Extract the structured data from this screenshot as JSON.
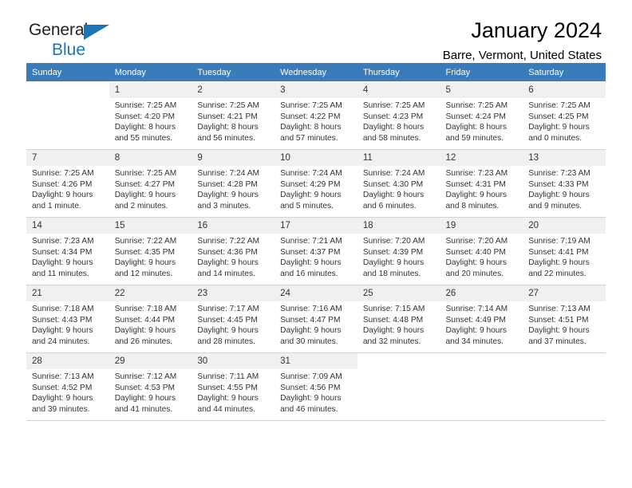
{
  "brand": {
    "name_part1": "General",
    "name_part2": "Blue",
    "accent_color": "#1b75bb"
  },
  "header": {
    "title": "January 2024",
    "subtitle": "Barre, Vermont, United States"
  },
  "calendar": {
    "header_bg": "#3a7cb9",
    "daynum_bg": "#f0f0f0",
    "weekday_headers": [
      "Sunday",
      "Monday",
      "Tuesday",
      "Wednesday",
      "Thursday",
      "Friday",
      "Saturday"
    ],
    "weeks": [
      [
        {
          "day": "",
          "sunrise": "",
          "sunset": "",
          "daylight": "",
          "blank": true
        },
        {
          "day": "1",
          "sunrise": "Sunrise: 7:25 AM",
          "sunset": "Sunset: 4:20 PM",
          "daylight": "Daylight: 8 hours and 55 minutes."
        },
        {
          "day": "2",
          "sunrise": "Sunrise: 7:25 AM",
          "sunset": "Sunset: 4:21 PM",
          "daylight": "Daylight: 8 hours and 56 minutes."
        },
        {
          "day": "3",
          "sunrise": "Sunrise: 7:25 AM",
          "sunset": "Sunset: 4:22 PM",
          "daylight": "Daylight: 8 hours and 57 minutes."
        },
        {
          "day": "4",
          "sunrise": "Sunrise: 7:25 AM",
          "sunset": "Sunset: 4:23 PM",
          "daylight": "Daylight: 8 hours and 58 minutes."
        },
        {
          "day": "5",
          "sunrise": "Sunrise: 7:25 AM",
          "sunset": "Sunset: 4:24 PM",
          "daylight": "Daylight: 8 hours and 59 minutes."
        },
        {
          "day": "6",
          "sunrise": "Sunrise: 7:25 AM",
          "sunset": "Sunset: 4:25 PM",
          "daylight": "Daylight: 9 hours and 0 minutes."
        }
      ],
      [
        {
          "day": "7",
          "sunrise": "Sunrise: 7:25 AM",
          "sunset": "Sunset: 4:26 PM",
          "daylight": "Daylight: 9 hours and 1 minute."
        },
        {
          "day": "8",
          "sunrise": "Sunrise: 7:25 AM",
          "sunset": "Sunset: 4:27 PM",
          "daylight": "Daylight: 9 hours and 2 minutes."
        },
        {
          "day": "9",
          "sunrise": "Sunrise: 7:24 AM",
          "sunset": "Sunset: 4:28 PM",
          "daylight": "Daylight: 9 hours and 3 minutes."
        },
        {
          "day": "10",
          "sunrise": "Sunrise: 7:24 AM",
          "sunset": "Sunset: 4:29 PM",
          "daylight": "Daylight: 9 hours and 5 minutes."
        },
        {
          "day": "11",
          "sunrise": "Sunrise: 7:24 AM",
          "sunset": "Sunset: 4:30 PM",
          "daylight": "Daylight: 9 hours and 6 minutes."
        },
        {
          "day": "12",
          "sunrise": "Sunrise: 7:23 AM",
          "sunset": "Sunset: 4:31 PM",
          "daylight": "Daylight: 9 hours and 8 minutes."
        },
        {
          "day": "13",
          "sunrise": "Sunrise: 7:23 AM",
          "sunset": "Sunset: 4:33 PM",
          "daylight": "Daylight: 9 hours and 9 minutes."
        }
      ],
      [
        {
          "day": "14",
          "sunrise": "Sunrise: 7:23 AM",
          "sunset": "Sunset: 4:34 PM",
          "daylight": "Daylight: 9 hours and 11 minutes."
        },
        {
          "day": "15",
          "sunrise": "Sunrise: 7:22 AM",
          "sunset": "Sunset: 4:35 PM",
          "daylight": "Daylight: 9 hours and 12 minutes."
        },
        {
          "day": "16",
          "sunrise": "Sunrise: 7:22 AM",
          "sunset": "Sunset: 4:36 PM",
          "daylight": "Daylight: 9 hours and 14 minutes."
        },
        {
          "day": "17",
          "sunrise": "Sunrise: 7:21 AM",
          "sunset": "Sunset: 4:37 PM",
          "daylight": "Daylight: 9 hours and 16 minutes."
        },
        {
          "day": "18",
          "sunrise": "Sunrise: 7:20 AM",
          "sunset": "Sunset: 4:39 PM",
          "daylight": "Daylight: 9 hours and 18 minutes."
        },
        {
          "day": "19",
          "sunrise": "Sunrise: 7:20 AM",
          "sunset": "Sunset: 4:40 PM",
          "daylight": "Daylight: 9 hours and 20 minutes."
        },
        {
          "day": "20",
          "sunrise": "Sunrise: 7:19 AM",
          "sunset": "Sunset: 4:41 PM",
          "daylight": "Daylight: 9 hours and 22 minutes."
        }
      ],
      [
        {
          "day": "21",
          "sunrise": "Sunrise: 7:18 AM",
          "sunset": "Sunset: 4:43 PM",
          "daylight": "Daylight: 9 hours and 24 minutes."
        },
        {
          "day": "22",
          "sunrise": "Sunrise: 7:18 AM",
          "sunset": "Sunset: 4:44 PM",
          "daylight": "Daylight: 9 hours and 26 minutes."
        },
        {
          "day": "23",
          "sunrise": "Sunrise: 7:17 AM",
          "sunset": "Sunset: 4:45 PM",
          "daylight": "Daylight: 9 hours and 28 minutes."
        },
        {
          "day": "24",
          "sunrise": "Sunrise: 7:16 AM",
          "sunset": "Sunset: 4:47 PM",
          "daylight": "Daylight: 9 hours and 30 minutes."
        },
        {
          "day": "25",
          "sunrise": "Sunrise: 7:15 AM",
          "sunset": "Sunset: 4:48 PM",
          "daylight": "Daylight: 9 hours and 32 minutes."
        },
        {
          "day": "26",
          "sunrise": "Sunrise: 7:14 AM",
          "sunset": "Sunset: 4:49 PM",
          "daylight": "Daylight: 9 hours and 34 minutes."
        },
        {
          "day": "27",
          "sunrise": "Sunrise: 7:13 AM",
          "sunset": "Sunset: 4:51 PM",
          "daylight": "Daylight: 9 hours and 37 minutes."
        }
      ],
      [
        {
          "day": "28",
          "sunrise": "Sunrise: 7:13 AM",
          "sunset": "Sunset: 4:52 PM",
          "daylight": "Daylight: 9 hours and 39 minutes."
        },
        {
          "day": "29",
          "sunrise": "Sunrise: 7:12 AM",
          "sunset": "Sunset: 4:53 PM",
          "daylight": "Daylight: 9 hours and 41 minutes."
        },
        {
          "day": "30",
          "sunrise": "Sunrise: 7:11 AM",
          "sunset": "Sunset: 4:55 PM",
          "daylight": "Daylight: 9 hours and 44 minutes."
        },
        {
          "day": "31",
          "sunrise": "Sunrise: 7:09 AM",
          "sunset": "Sunset: 4:56 PM",
          "daylight": "Daylight: 9 hours and 46 minutes."
        },
        {
          "day": "",
          "sunrise": "",
          "sunset": "",
          "daylight": "",
          "blank": true
        },
        {
          "day": "",
          "sunrise": "",
          "sunset": "",
          "daylight": "",
          "blank": true
        },
        {
          "day": "",
          "sunrise": "",
          "sunset": "",
          "daylight": "",
          "blank": true
        }
      ]
    ]
  }
}
